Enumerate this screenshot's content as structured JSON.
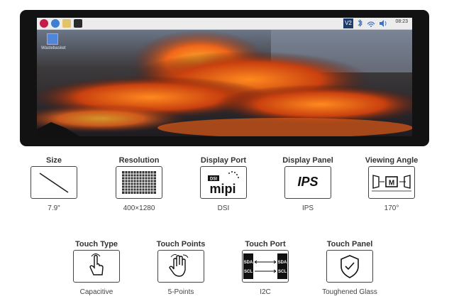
{
  "screen": {
    "desktop_icon_label": "Wastebasket",
    "clock": "08:23",
    "vnc_label": "V2"
  },
  "specs": [
    {
      "title": "Size",
      "value": "7.9\"",
      "icon": "diagonal-line-icon"
    },
    {
      "title": "Resolution",
      "value": "400×1280",
      "icon": "pixel-grid-icon"
    },
    {
      "title": "Display Port",
      "value": "DSI",
      "icon": "dsi-mipi-icon",
      "icon_text_top": "DSI",
      "icon_text_main": "mipi"
    },
    {
      "title": "Display Panel",
      "value": "IPS",
      "icon": "ips-icon",
      "icon_text": "IPS"
    },
    {
      "title": "Viewing Angle",
      "value": "170°",
      "icon": "viewing-angle-icon",
      "icon_text": "M"
    },
    {
      "title": "Touch Type",
      "value": "Capacitive",
      "icon": "finger-touch-icon"
    },
    {
      "title": "Touch Points",
      "value": "5-Points",
      "icon": "five-finger-hand-icon"
    },
    {
      "title": "Touch Port",
      "value": "I2C",
      "icon": "i2c-port-icon",
      "icon_labels": [
        "SDA",
        "SCL",
        "SDA",
        "SCL"
      ]
    },
    {
      "title": "Touch Panel",
      "value": "Toughened Glass",
      "icon": "shield-check-icon"
    }
  ]
}
